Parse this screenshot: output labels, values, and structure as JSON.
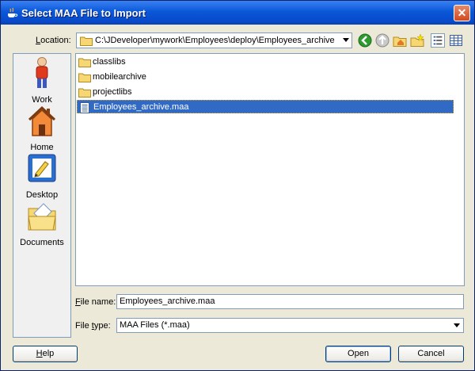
{
  "window": {
    "title": "Select MAA File to Import",
    "close": "✕"
  },
  "location": {
    "label_mnemonic": "L",
    "label_rest": "ocation:",
    "value": "C:\\JDeveloper\\mywork\\Employees\\deploy\\Employees_archive"
  },
  "toolbar": {
    "icons": [
      "back-icon",
      "up-folder-icon",
      "home-folder-icon",
      "new-folder-icon",
      "list-view-icon",
      "details-view-icon"
    ]
  },
  "places": [
    {
      "label": "Work",
      "icon": "work-person-icon"
    },
    {
      "label": "Home",
      "icon": "home-icon"
    },
    {
      "label": "Desktop",
      "icon": "desktop-icon"
    },
    {
      "label": "Documents",
      "icon": "documents-icon"
    }
  ],
  "files": [
    {
      "name": "classlibs",
      "type": "folder"
    },
    {
      "name": "mobilearchive",
      "type": "folder"
    },
    {
      "name": "projectlibs",
      "type": "folder"
    },
    {
      "name": "Employees_archive.maa",
      "type": "file",
      "selected": true
    }
  ],
  "file_name": {
    "label_mnemonic": "F",
    "label_rest": "ile name:",
    "value": "Employees_archive.maa"
  },
  "file_type": {
    "label_prefix": "File ",
    "label_mnemonic": "t",
    "label_rest": "ype:",
    "value": "MAA Files (*.maa)"
  },
  "buttons": {
    "help_mnemonic": "H",
    "help_rest": "elp",
    "open": "Open",
    "cancel": "Cancel"
  },
  "colors": {
    "title_bar": "#0a58d8",
    "selection": "#316ac5",
    "dialog_bg": "#ece9d8"
  }
}
